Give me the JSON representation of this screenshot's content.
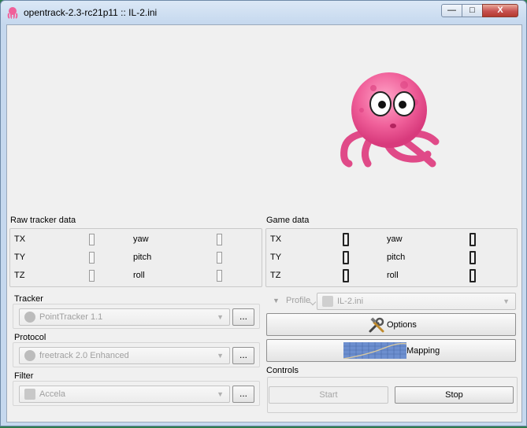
{
  "window": {
    "title": "opentrack-2.3-rc21p11 :: IL-2.ini",
    "min_label": "—",
    "max_label": "□",
    "close_label": "X"
  },
  "raw_tracker": {
    "title": "Raw tracker data",
    "rows": [
      {
        "left": "TX",
        "right": "yaw"
      },
      {
        "left": "TY",
        "right": "pitch"
      },
      {
        "left": "TZ",
        "right": "roll"
      }
    ]
  },
  "game_data": {
    "title": "Game data",
    "rows": [
      {
        "left": "TX",
        "right": "yaw"
      },
      {
        "left": "TY",
        "right": "pitch"
      },
      {
        "left": "TZ",
        "right": "roll"
      }
    ]
  },
  "tracker": {
    "label": "Tracker",
    "value": "PointTracker 1.1",
    "button": "..."
  },
  "protocol": {
    "label": "Protocol",
    "value": "freetrack 2.0 Enhanced",
    "button": "..."
  },
  "filter": {
    "label": "Filter",
    "value": "Accela",
    "button": "..."
  },
  "profile": {
    "label": "Profile",
    "value": "IL-2.ini"
  },
  "buttons": {
    "options": "Options",
    "mapping": "Mapping"
  },
  "controls": {
    "label": "Controls",
    "start": "Start",
    "stop": "Stop"
  },
  "colors": {
    "octopus": "#f0609a",
    "titlebar": "#c5d8ee",
    "client": "#f0f0f0"
  }
}
